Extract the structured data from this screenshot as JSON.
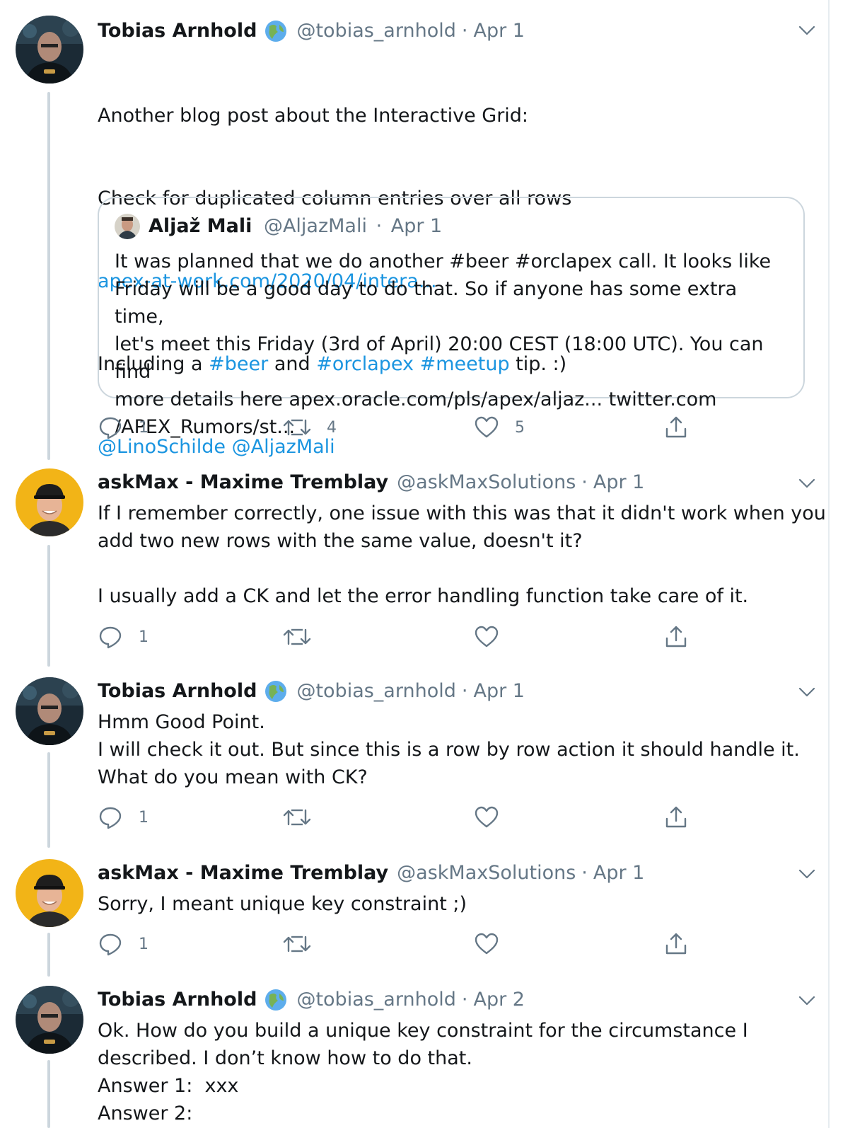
{
  "tweets": [
    {
      "name": "Tobias Arnhold",
      "handle": "@tobias_arnhold",
      "sep": "·",
      "date": "Apr 1",
      "lines": [
        {
          "text": "Another blog post about the Interactive Grid:"
        },
        {
          "text": "Check for duplicated column entries over all rows"
        },
        {
          "link": "apex-at-work.com/2020/04/intera..."
        },
        {
          "pre": "Including a ",
          "tag1": "#beer",
          "mid": " and ",
          "tag2": "#orclapex",
          "sp": " ",
          "tag3": "#meetup",
          "post": " tip. :)"
        },
        {
          "m1": "@LinoSchilde",
          "sp": " ",
          "m2": "@AljazMali"
        }
      ],
      "quote": {
        "name": "Aljaž Mali",
        "handle": "@AljazMali",
        "sep": "·",
        "date": "Apr 1",
        "text": "It was planned that we do another #beer #orclapex call. It looks like\nFriday will be a good day to do that. So if anyone has some extra time,\nlet's meet this Friday (3rd of April) 20:00 CEST (18:00 UTC). You can find\nmore details here apex.oracle.com/pls/apex/aljaz... twitter.com\n/APEX_Rumors/st..."
      },
      "replies": "1",
      "retweets": "4",
      "likes": "5"
    },
    {
      "name": "askMax - Maxime Tremblay",
      "handle": "@askMaxSolutions",
      "sep": "·",
      "date": "Apr 1",
      "text": "If I remember correctly, one issue with this was that it didn't work when you\nadd two new rows with the same value, doesn't it?\n\nI usually add a CK and let the error handling function take care of it.",
      "replies": "1"
    },
    {
      "name": "Tobias Arnhold",
      "handle": "@tobias_arnhold",
      "sep": "·",
      "date": "Apr 1",
      "text": "Hmm Good Point.\nI will check it out. But since this is a row by row action it should handle it.\nWhat do you mean with CK?",
      "replies": "1"
    },
    {
      "name": "askMax - Maxime Tremblay",
      "handle": "@askMaxSolutions",
      "sep": "·",
      "date": "Apr 1",
      "text": "Sorry, I meant unique key constraint ;)",
      "replies": "1"
    },
    {
      "name": "Tobias Arnhold",
      "handle": "@tobias_arnhold",
      "sep": "·",
      "date": "Apr 2",
      "text": "Ok. How do you build a unique key constraint for the circumstance I\ndescribed. I don’t know how to do that.\nAnswer 1:  xxx\nAnswer 2:"
    }
  ],
  "icons": {
    "reply": "reply-icon",
    "retweet": "retweet-icon",
    "like": "heart-icon",
    "share": "share-icon",
    "more": "chevron-down-icon",
    "verified_globe": "globe-emoji-icon"
  },
  "colors": {
    "link": "#1b95e0",
    "secondary": "#657786",
    "thread_line": "#ccd6dd",
    "text": "#14171a"
  }
}
